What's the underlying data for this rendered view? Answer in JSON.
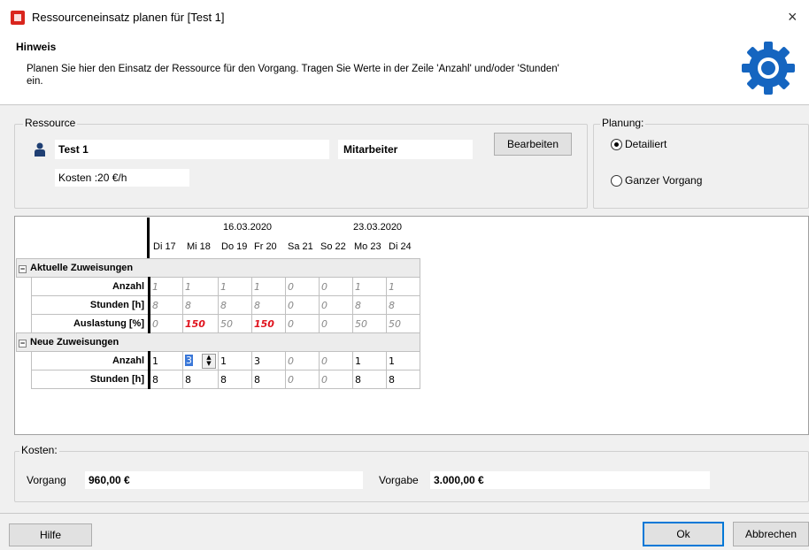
{
  "window": {
    "title": "Ressourceneinsatz planen für [Test 1]",
    "close": "×"
  },
  "hint": {
    "title": "Hinweis",
    "text": "Planen Sie hier den Einsatz der Ressource für den Vorgang. Tragen Sie Werte in der Zeile 'Anzahl' und/oder 'Stunden' ein."
  },
  "resource": {
    "legend": "Ressource",
    "name": "Test 1",
    "type": "Mitarbeiter",
    "cost": "Kosten :20 €/h",
    "edit_label": "Bearbeiten"
  },
  "planning": {
    "legend": "Planung:",
    "option_detailed": "Detailiert",
    "option_whole": "Ganzer Vorgang",
    "selected": "Detailiert"
  },
  "grid": {
    "week_dates": [
      "16.03.2020",
      "23.03.2020"
    ],
    "days": [
      "Di 17",
      "Mi 18",
      "Do 19",
      "Fr 20",
      "Sa 21",
      "So 22",
      "Mo 23",
      "Di 24"
    ],
    "current_section": "Aktuelle Zuweisungen",
    "current_rows": [
      {
        "label": "Anzahl",
        "values": [
          "1",
          "1",
          "1",
          "1",
          "0",
          "0",
          "1",
          "1"
        ]
      },
      {
        "label": "Stunden [h]",
        "values": [
          "8",
          "8",
          "8",
          "8",
          "0",
          "0",
          "8",
          "8"
        ]
      },
      {
        "label": "Auslastung [%]",
        "values": [
          "0",
          "150",
          "50",
          "150",
          "0",
          "0",
          "50",
          "50"
        ]
      }
    ],
    "new_section": "Neue Zuweisungen",
    "new_rows": [
      {
        "label": "Anzahl",
        "values": [
          "1",
          "3",
          "1",
          "3",
          "0",
          "0",
          "1",
          "1"
        ]
      },
      {
        "label": "Stunden [h]",
        "values": [
          "8",
          "8",
          "8",
          "8",
          "0",
          "0",
          "8",
          "8"
        ]
      }
    ]
  },
  "costs": {
    "legend": "Kosten:",
    "vorgang_label": "Vorgang",
    "vorgang_value": "960,00 €",
    "vorgabe_label": "Vorgabe",
    "vorgabe_value": "3.000,00 €"
  },
  "buttons": {
    "help": "Hilfe",
    "ok": "Ok",
    "cancel": "Abbrechen"
  },
  "colors": {
    "warning": "#e0141e",
    "gear": "#1565c0",
    "app_icon": "#d9251d"
  }
}
